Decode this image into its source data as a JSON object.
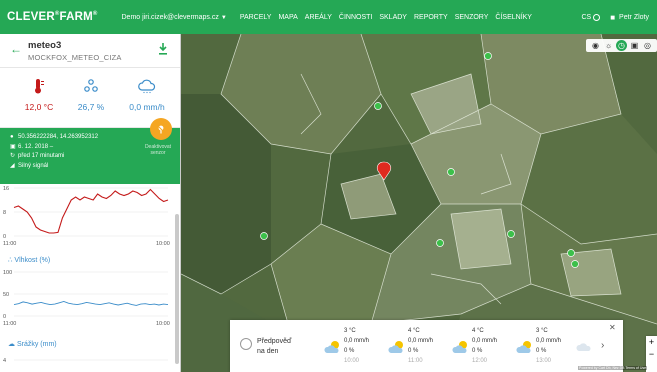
{
  "header": {
    "logo": "CLEVER",
    "logo_mark": "®",
    "logo_suffix": "FARM",
    "logo_mark2": "®",
    "account": "Demo jiri.cizek@clevermaps.cz",
    "nav": [
      "PARCELY",
      "MAPA",
      "AREÁLY",
      "ČINNOSTI",
      "SKLADY",
      "REPORTY",
      "SENZORY",
      "ČÍSELNÍKY"
    ],
    "language": "CS",
    "user": "Petr Zloty"
  },
  "sensor": {
    "name": "meteo3",
    "id": "MOCKFOX_METEO_CIZA",
    "temperature": "12,0 °C",
    "humidity": "26,7 %",
    "precipitation": "0,0 mm/h",
    "coordinates": "50.356222284, 14.263952312",
    "date": "6. 12. 2018 –",
    "last_update": "před 17 minutami",
    "signal": "Silný signál",
    "deactivate_label": "Deaktivovat senzor"
  },
  "colors": {
    "brand": "#25a855",
    "temp": "#c41a1a",
    "humidity": "#3a8cc9",
    "orange": "#f5a623"
  },
  "chart_data": [
    {
      "type": "line",
      "title": "",
      "x_ticks": [
        "11:00",
        "10:00"
      ],
      "y_ticks": [
        16,
        8,
        0
      ],
      "ylim": [
        0,
        16
      ],
      "series": [
        {
          "values": [
            9.5,
            10,
            9,
            8,
            6,
            3,
            2,
            1.5,
            1,
            1,
            1.2,
            6,
            9,
            12,
            13,
            12,
            13,
            12.5,
            12,
            14,
            13,
            12.5,
            13.5,
            15,
            14,
            13.5,
            14,
            15,
            14.5,
            13.5,
            14,
            15.5,
            14,
            12.5,
            11.5,
            12
          ]
        }
      ]
    },
    {
      "type": "line",
      "title": "Vlhkost (%)",
      "x_ticks": [
        "11:00",
        "10:00"
      ],
      "y_ticks": [
        100,
        50,
        0
      ],
      "ylim": [
        0,
        100
      ],
      "series": [
        {
          "values": [
            26,
            28,
            32,
            30,
            27,
            29,
            31,
            28,
            26,
            27,
            30,
            33,
            29,
            27,
            26,
            28,
            31,
            29,
            27,
            26,
            28,
            30,
            27,
            25,
            27,
            29,
            26,
            24,
            27,
            28,
            26,
            27,
            25,
            27,
            26
          ]
        }
      ]
    },
    {
      "type": "line",
      "title": "Srážky (mm)",
      "y_ticks": [
        4
      ],
      "ylim": [
        0,
        4
      ],
      "series": []
    }
  ],
  "map": {
    "tools": [
      "visibility-off-icon",
      "brightness-icon",
      "clock-icon",
      "calendar-icon",
      "signal-icon"
    ],
    "attribution": "Powered by Cart Db, Nez DB Terms of Use"
  },
  "forecast": {
    "label_line1": "Předpověď",
    "label_line2": "na den",
    "days": [
      {
        "temp": "3 °C",
        "rain": "0,0 mm/h",
        "pct": "0 %",
        "time": "10:00"
      },
      {
        "temp": "4 °C",
        "rain": "0,0 mm/h",
        "pct": "0 %",
        "time": "11:00"
      },
      {
        "temp": "4 °C",
        "rain": "0,0 mm/h",
        "pct": "0 %",
        "time": "12:00"
      },
      {
        "temp": "3 °C",
        "rain": "0,0 mm/h",
        "pct": "0 %",
        "time": "13:00"
      }
    ]
  }
}
